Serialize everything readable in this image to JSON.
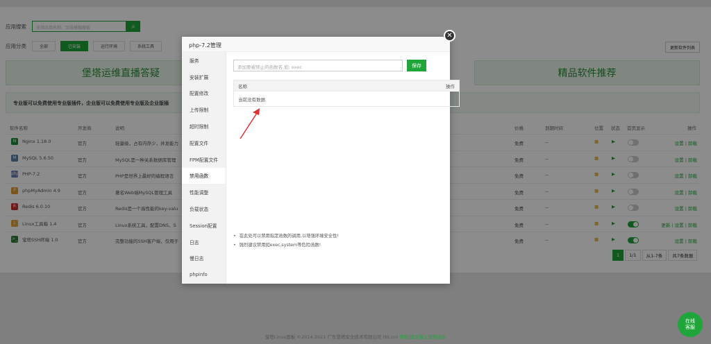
{
  "search": {
    "label": "应用搜索",
    "placeholder": "支持应用名称、字段模糊搜索"
  },
  "categories": {
    "label": "应用分类",
    "items": [
      "全部",
      "已安装",
      "运行环境",
      "系统工具"
    ],
    "selected": "已安装"
  },
  "update_list_btn": "更新软件列表",
  "banners": {
    "left": "堡塔运维直播答疑",
    "right": "精品软件推荐"
  },
  "tip": "专业版可以免费使用专业版插件，企业版可以免费使用专业版及企业版插",
  "table": {
    "headers": {
      "name": "软件名称",
      "dev": "开发商",
      "desc": "说明",
      "price": "价格",
      "expire": "到期时间",
      "loc": "位置",
      "status": "状态",
      "home": "首页显示",
      "ops": "操作"
    },
    "rows": [
      {
        "name": "Nginx 1.18.0",
        "dev": "官方",
        "desc": "轻量级，占有内存少，并发能力",
        "price": "免费",
        "expire": "--",
        "ops": "设置 | 卸载",
        "icon": "N",
        "color": "#1a8c3a",
        "home": false
      },
      {
        "name": "MySQL 5.6.50",
        "dev": "官方",
        "desc": "MySQL是一种关系数据库管理",
        "price": "免费",
        "expire": "--",
        "ops": "设置 | 卸载",
        "icon": "M",
        "color": "#5b7fa6",
        "home": false
      },
      {
        "name": "PHP-7.2",
        "dev": "官方",
        "desc": "PHP是世界上最好的编程语言",
        "price": "免费",
        "expire": "--",
        "ops": "设置 | 卸载",
        "icon": "php",
        "color": "#6a7fb5",
        "home": false
      },
      {
        "name": "phpMyAdmin 4.9",
        "dev": "官方",
        "desc": "著名Web端MySQL管理工具",
        "price": "免费",
        "expire": "--",
        "ops": "设置 | 卸载",
        "icon": "P",
        "color": "#e39b2d",
        "home": false
      },
      {
        "name": "Redis 6.0.10",
        "dev": "官方",
        "desc": "Redis是一个高性能的key-valu",
        "price": "免费",
        "expire": "--",
        "ops": "设置 | 卸载",
        "icon": "R",
        "color": "#c9302c",
        "home": false
      },
      {
        "name": "Linux工具箱 1.4",
        "dev": "官方",
        "desc": "Linux系统工具，配置DNS、S",
        "price": "免费",
        "expire": "--",
        "ops": "更新 | 设置 | 卸载",
        "icon": "L",
        "color": "#e0a43a",
        "home": true
      },
      {
        "name": "宝塔SSH终端 1.0",
        "dev": "官方",
        "desc": "完整功能的SSH客户端，仅用于",
        "price": "免费",
        "expire": "--",
        "ops": "设置 | 卸载",
        "icon": ">_",
        "color": "#2f7d3a",
        "home": true
      }
    ]
  },
  "pager": {
    "current": "1",
    "pages": "1/1",
    "range": "从1-7条",
    "total": "共7条数据"
  },
  "modal": {
    "title": "php-7.2管理",
    "menu": [
      "服务",
      "安装扩展",
      "配置修改",
      "上传限制",
      "超时限制",
      "配置文件",
      "FPM配置文件",
      "禁用函数",
      "性能调整",
      "负载状态",
      "Session配置",
      "日志",
      "慢日志",
      "phpinfo"
    ],
    "active": "禁用函数",
    "input_placeholder": "添加要被禁止的函数名,如: exec",
    "save": "保存",
    "col_name": "名称",
    "col_ops": "操作",
    "empty": "当前没有数据",
    "notes": [
      "在此处可以禁用指定函数的调用,以增强环境安全性!",
      "强烈建议禁用如exec,system等危险函数!"
    ]
  },
  "footer": {
    "text": "宝塔Linux面板 ©2014-2021 广东堡塔安全技术有限公司 (bt.cn)",
    "link": "求助|建议请上宝塔论坛"
  },
  "online": {
    "line1": "在线",
    "line2": "客服"
  },
  "colors": {
    "accent": "#20a53a"
  }
}
